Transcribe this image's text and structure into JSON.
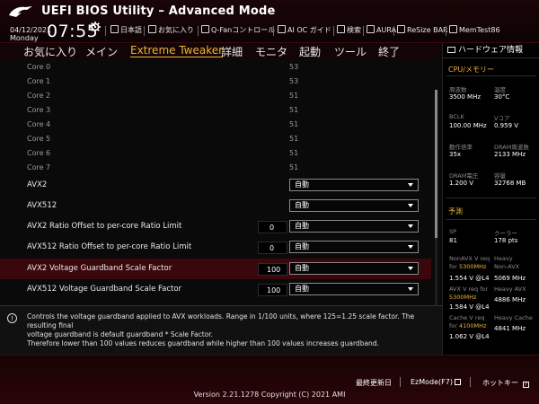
{
  "header": {
    "title": "UEFI BIOS Utility – Advanced Mode",
    "date": "04/12/2021",
    "day": "Monday",
    "time": "07:55",
    "tools": [
      "日本語",
      "お気に入り",
      "Q-Fanコントロール",
      "AI OC ガイド",
      "検索",
      "AURA",
      "ReSize BAR",
      "MemTest86"
    ]
  },
  "nav": {
    "tabs": [
      "お気に入り",
      "メイン",
      "Extreme Tweaker",
      "詳細",
      "モニタ",
      "起動",
      "ツール",
      "終了"
    ],
    "active": "Extreme Tweaker"
  },
  "cores": [
    {
      "label": "Core 0",
      "value": "53"
    },
    {
      "label": "Core 1",
      "value": "53"
    },
    {
      "label": "Core 2",
      "value": "51"
    },
    {
      "label": "Core 3",
      "value": "51"
    },
    {
      "label": "Core 4",
      "value": "51"
    },
    {
      "label": "Core 5",
      "value": "51"
    },
    {
      "label": "Core 6",
      "value": "51"
    },
    {
      "label": "Core 7",
      "value": "51"
    }
  ],
  "options": [
    {
      "label": "AVX2",
      "number": "",
      "select": "自動"
    },
    {
      "label": "AVX512",
      "number": "",
      "select": "自動"
    },
    {
      "label": "AVX2 Ratio Offset to per-core Ratio Limit",
      "number": "0",
      "select": "自動"
    },
    {
      "label": "AVX512 Ratio Offset to per-core Ratio Limit",
      "number": "0",
      "select": "自動"
    },
    {
      "label": "AVX2 Voltage Guardband Scale Factor",
      "number": "100",
      "select": "自動"
    },
    {
      "label": "AVX512 Voltage Guardband Scale Factor",
      "number": "100",
      "select": "自動"
    }
  ],
  "info": {
    "line1": "Controls the voltage guardband applied to AVX workloads. Range in 1/100 units, where 125=1.25 scale factor. The resulting final",
    "line2": "voltage guardband is default guardband * Scale Factor.",
    "line3": "Therefore lower than 100 values reduces guardband while higher than 100 values increases guardband."
  },
  "hw": {
    "header": "ハードウェア情報",
    "cpu_section": "CPU/メモリー",
    "freq_label": "周波数",
    "freq": "3500 MHz",
    "temp_label": "温度",
    "temp": "30°C",
    "bclk_label": "BCLK",
    "bclk": "100.00 MHz",
    "vcore_label": "Vコア",
    "vcore": "0.959 V",
    "ratio_label": "動作倍率",
    "ratio": "35x",
    "dram_label": "DRAM周波数",
    "dram": "2133 MHz",
    "dramv_label": "DRAM電圧",
    "dramv": "1.200 V",
    "cap_label": "容量",
    "cap": "32768 MB",
    "pred_section": "予測",
    "sp_label": "SP",
    "sp": "81",
    "cooler_label": "クーラー",
    "cooler": "178 pts",
    "nonavx_label": "NonAVX V req",
    "nonavx_for": "for",
    "nonavx_freq": "5300MHz",
    "heavy_nonavx_label1": "Heavy",
    "heavy_nonavx_label2": "Non-AVX",
    "nonavx_v": "1.554 V @L4",
    "heavy_nonavx": "5069 MHz",
    "avx_label": "AVX V req",
    "avx_for": "for",
    "avx_freq": "5300MHz",
    "heavy_avx_label": "Heavy AVX",
    "avx_v": "1.584 V @L4",
    "heavy_avx": "4886 MHz",
    "cache_label": "Cache V req",
    "cache_for": "for",
    "cache_freq": "4100MHz",
    "heavy_cache_label": "Heavy Cache",
    "cache_v": "1.062 V @L4",
    "heavy_cache": "4841 MHz"
  },
  "footer": {
    "last_modified": "最終更新日",
    "ezmode": "EzMode(F7)",
    "hotkey": "ホットキー",
    "hotkey_suffix": "?",
    "copyright": "Version 2.21.1278 Copyright (C) 2021 AMI"
  }
}
